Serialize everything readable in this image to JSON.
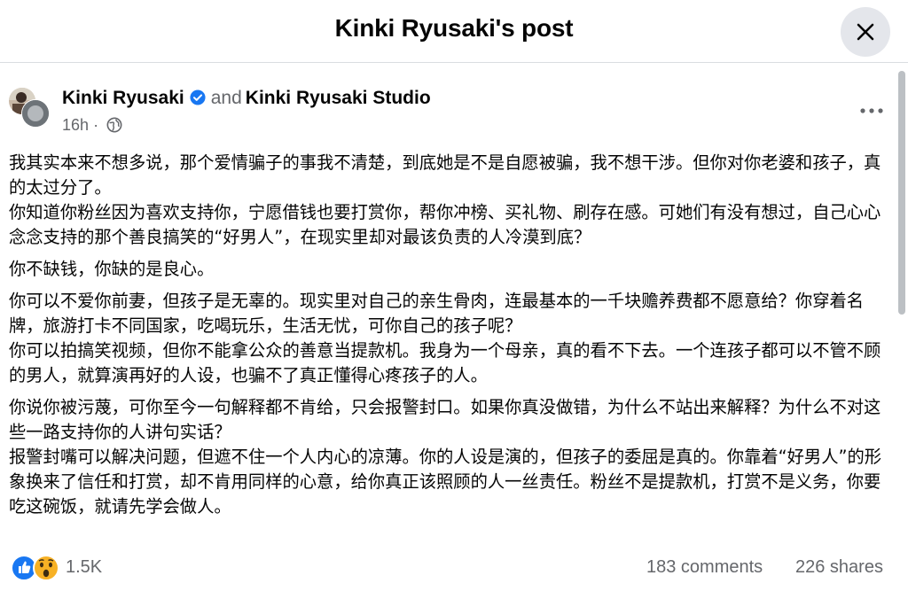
{
  "header": {
    "title": "Kinki Ryusaki's post",
    "close_icon": "close-icon"
  },
  "post": {
    "author": "Kinki Ryusaki",
    "connector": "and",
    "coauthor": "Kinki Ryusaki Studio",
    "time": "16h",
    "separator": "·",
    "privacy_icon": "globe-icon",
    "more_icon": "more-dots-icon",
    "paragraphs": [
      "我其实本来不想多说，那个爱情骗子的事我不清楚，到底她是不是自愿被骗，我不想干涉。但你对你老婆和孩子，真的太过分了。\n你知道你粉丝因为喜欢支持你，宁愿借钱也要打赏你，帮你冲榜、买礼物、刷存在感。可她们有没有想过，自己心心念念支持的那个善良搞笑的“好男人”，在现实里却对最该负责的人冷漠到底？",
      "你不缺钱，你缺的是良心。",
      "你可以不爱你前妻，但孩子是无辜的。现实里对自己的亲生骨肉，连最基本的一千块赡养费都不愿意给？你穿着名牌，旅游打卡不同国家，吃喝玩乐，生活无忧，可你自己的孩子呢？\n你可以拍搞笑视频，但你不能拿公众的善意当提款机。我身为一个母亲，真的看不下去。一个连孩子都可以不管不顾的男人，就算演再好的人设，也骗不了真正懂得心疼孩子的人。",
      "你说你被污蔑，可你至今一句解释都不肯给，只会报警封口。如果你真没做错，为什么不站出来解释？为什么不对这些一路支持你的人讲句实话？\n报警封嘴可以解决问题，但遮不住一个人内心的凉薄。你的人设是演的，但孩子的委屈是真的。你靠着“好男人”的形象换来了信任和打赏，却不肯用同样的心意，给你真正该照顾的人一丝责任。粉丝不是提款机，打赏不是义务，你要吃这碗饭，就请先学会做人。"
    ]
  },
  "footer": {
    "reaction_count": "1.5K",
    "comments": "183 comments",
    "shares": "226 shares",
    "reaction_icons": [
      "like-icon",
      "wow-icon"
    ]
  },
  "colors": {
    "brand_blue": "#1877f2",
    "secondary_text": "#65676b",
    "wow_yellow": "#f7b125"
  }
}
